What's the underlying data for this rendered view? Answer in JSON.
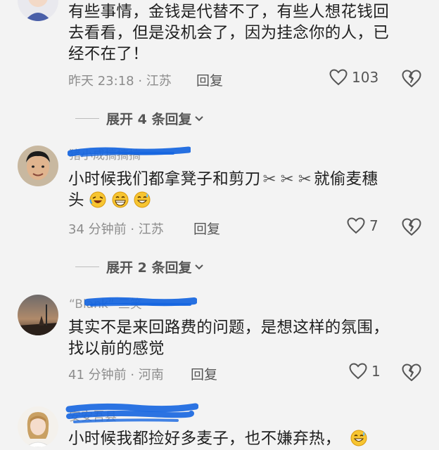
{
  "comments": [
    {
      "text_lines": [
        "有些事情，金钱是代替不了，有些人想花钱回",
        "去看看，但是没机会了，因为挂念你的人，已",
        "经不在了！"
      ],
      "time": "昨天 23:18 · 江苏",
      "reply_label": "回复",
      "likes": "103",
      "expand_label": "展开 4 条回复"
    },
    {
      "username": "猪小成搞搞搞",
      "text_line1": "小时候我们都拿凳子和剪刀",
      "text_line1_after": "就偷麦穗",
      "text_line2": "头",
      "scissors_glyph": "✂",
      "time": "34 分钟前 · 江苏",
      "reply_label": "回复",
      "likes": "7",
      "expand_label": "展开 2 条回复"
    },
    {
      "username": "“Blank” 三笑",
      "text_lines": [
        "其实不是来回路费的问题，是想这样的氛围，",
        "找以前的感觉"
      ],
      "time": "41 分钟前 · 河南",
      "reply_label": "回复",
      "likes": "1"
    },
    {
      "username": "安安吾县",
      "text_line1": "小时候我都捡好多麦子，也不嫌弃热，"
    }
  ],
  "colors": {
    "background": "#f3f3f3",
    "scribble": "#1565e0",
    "meta": "#8c8c8c"
  },
  "icons": [
    "heart-outline-icon",
    "broken-heart-icon",
    "chevron-down-icon",
    "scissors-icon",
    "laughing-emoji-icon",
    "grinning-emoji-icon",
    "sweat-emoji-icon"
  ]
}
